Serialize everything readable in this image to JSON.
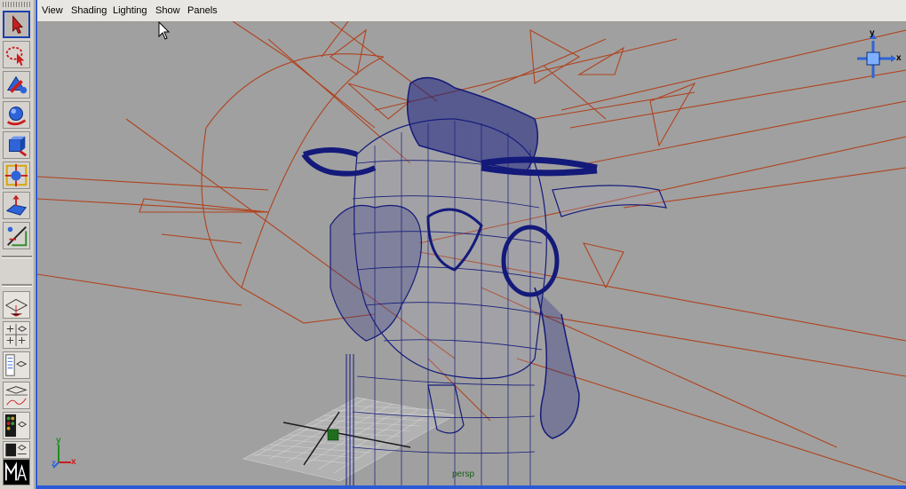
{
  "viewport": {
    "menus": [
      "View",
      "Shading",
      "Lighting",
      "Show",
      "Panels"
    ],
    "camera_label": "persp",
    "viewcube_axes": {
      "y": "y",
      "x": "x"
    },
    "origin_axes": {
      "y": "y",
      "z": "z",
      "x": "x"
    }
  },
  "toolbox": {
    "tools": [
      "select-tool",
      "lasso-select-tool",
      "paint-select-tool",
      "move-tool",
      "rotate-tool",
      "scale-tool",
      "universal-manipulator-tool",
      "show-manipulator-tool"
    ],
    "active_tool": "select-tool",
    "layouts": [
      "single-perspective-layout",
      "four-view-layout",
      "perspective-outliner-layout",
      "perspective-graph-layout",
      "hypershade-layout"
    ],
    "logo_text": "Maya"
  },
  "colors": {
    "viewport_bg": "#a0a0a0",
    "wireframe": "#141a7a",
    "lights": "#b0431e",
    "grid": "#d2d2d2",
    "accent": "#2a5bd7"
  }
}
